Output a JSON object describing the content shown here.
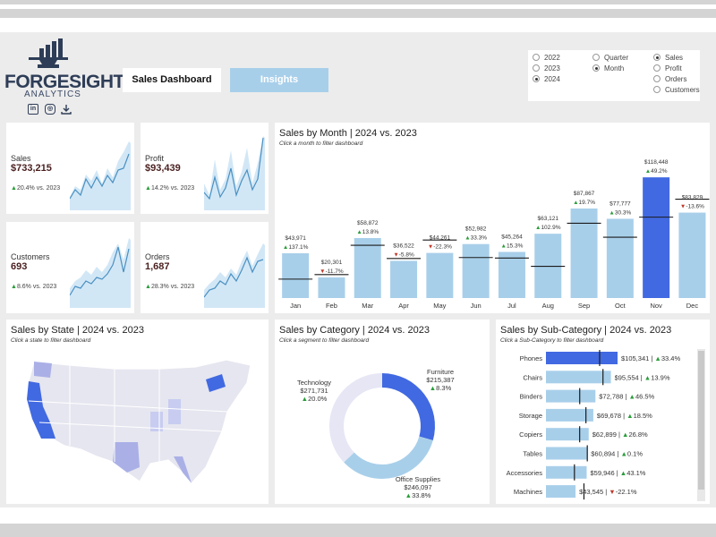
{
  "header": {
    "logo_text": "FORGESIGHT",
    "logo_sub": "ANALYTICS",
    "nav_buttons": [
      "Sales Dashboard",
      "Insights"
    ]
  },
  "filters": {
    "years": [
      {
        "label": "2022",
        "selected": false
      },
      {
        "label": "2023",
        "selected": false
      },
      {
        "label": "2024",
        "selected": true
      }
    ],
    "granularity": [
      {
        "label": "Quarter",
        "selected": false
      },
      {
        "label": "Month",
        "selected": true
      }
    ],
    "measures": [
      {
        "label": "Sales",
        "selected": true
      },
      {
        "label": "Profit",
        "selected": false
      },
      {
        "label": "Orders",
        "selected": false
      },
      {
        "label": "Customers",
        "selected": false
      }
    ]
  },
  "kpis": [
    {
      "title": "Sales",
      "value": "$733,215",
      "change": "20.4%",
      "suffix": " vs. 2023",
      "dir": "up"
    },
    {
      "title": "Profit",
      "value": "$93,439",
      "change": "14.2%",
      "suffix": " vs. 2023",
      "dir": "up"
    },
    {
      "title": "Customers",
      "value": "693",
      "change": "8.6%",
      "suffix": " vs. 2023",
      "dir": "up"
    },
    {
      "title": "Orders",
      "value": "1,687",
      "change": "28.3%",
      "suffix": " vs. 2023",
      "dir": "up"
    }
  ],
  "month_panel": {
    "title": "Sales by Month | 2024 vs. 2023",
    "subtitle": "Click a month to filter dashboard"
  },
  "state_panel": {
    "title": "Sales by State | 2024 vs. 2023",
    "subtitle": "Click a state to filter dashboard"
  },
  "category_panel": {
    "title": "Sales by Category | 2024 vs. 2023",
    "subtitle": "Click a segment to filter dashboard"
  },
  "subcat_panel": {
    "title": "Sales by Sub-Category | 2024 vs. 2023",
    "subtitle": "Click a Sub-Category to filter dashboard"
  },
  "chart_data": [
    {
      "type": "bar",
      "title": "Sales by Month | 2024 vs. 2023",
      "categories": [
        "Jan",
        "Feb",
        "Mar",
        "Apr",
        "May",
        "Jun",
        "Jul",
        "Aug",
        "Sep",
        "Oct",
        "Nov",
        "Dec"
      ],
      "series": [
        {
          "values": [
            43971,
            20301,
            58872,
            36522,
            44261,
            52982,
            45264,
            63121,
            87867,
            77777,
            118448,
            83829
          ]
        }
      ],
      "labels": [
        "$43,971",
        "$20,301",
        "$58,872",
        "$36,522",
        "$44,261",
        "$52,982",
        "$45,264",
        "$63,121",
        "$87,867",
        "$77,777",
        "$118,448",
        "$83,829"
      ],
      "changes": [
        {
          "text": "137.1%",
          "dir": "up"
        },
        {
          "text": "-11.7%",
          "dir": "down"
        },
        {
          "text": "13.8%",
          "dir": "up"
        },
        {
          "text": "-5.8%",
          "dir": "down"
        },
        {
          "text": "-22.3%",
          "dir": "down"
        },
        {
          "text": "33.3%",
          "dir": "up"
        },
        {
          "text": "15.3%",
          "dir": "up"
        },
        {
          "text": "102.9%",
          "dir": "up"
        },
        {
          "text": "19.7%",
          "dir": "up"
        },
        {
          "text": "30.3%",
          "dir": "up"
        },
        {
          "text": "49.2%",
          "dir": "up"
        },
        {
          "text": "-13.6%",
          "dir": "down"
        }
      ],
      "prior_year": [
        18546,
        22990,
        51740,
        38770,
        56960,
        39740,
        39260,
        31110,
        73410,
        59690,
        79380,
        97020
      ],
      "highlight_index": 10,
      "colors": {
        "bar": "#a8cfea",
        "highlight": "#4169e1",
        "prior_marker": "#1a1a1a"
      }
    },
    {
      "type": "pie",
      "title": "Sales by Category | 2024 vs. 2023",
      "categories": [
        "Technology",
        "Furniture",
        "Office Supplies"
      ],
      "values": [
        271731,
        215387,
        246097
      ],
      "value_labels": [
        "$271,731",
        "$215,387",
        "$246,097"
      ],
      "changes": [
        {
          "text": "20.0%",
          "dir": "up"
        },
        {
          "text": "8.3%",
          "dir": "up"
        },
        {
          "text": "33.8%",
          "dir": "up"
        }
      ],
      "colors": [
        "#e6e6f5",
        "#4169e1",
        "#a8cfea"
      ]
    },
    {
      "type": "bar",
      "title": "Sales by Sub-Category | 2024 vs. 2023",
      "categories": [
        "Phones",
        "Chairs",
        "Binders",
        "Storage",
        "Copiers",
        "Tables",
        "Accessories",
        "Machines"
      ],
      "series": [
        {
          "values": [
            105341,
            95554,
            72788,
            69678,
            62899,
            60894,
            59946,
            43545
          ]
        }
      ],
      "labels": [
        "$105,341",
        "$95,554",
        "$72,788",
        "$69,678",
        "$62,899",
        "$60,894",
        "$59,946",
        "$43,545"
      ],
      "changes": [
        {
          "text": "33.4%",
          "dir": "up"
        },
        {
          "text": "13.9%",
          "dir": "up"
        },
        {
          "text": "46.5%",
          "dir": "up"
        },
        {
          "text": "18.5%",
          "dir": "up"
        },
        {
          "text": "26.8%",
          "dir": "up"
        },
        {
          "text": "0.1%",
          "dir": "up"
        },
        {
          "text": "43.1%",
          "dir": "up"
        },
        {
          "text": "-22.1%",
          "dir": "down"
        }
      ],
      "prior_year": [
        78970,
        83890,
        49680,
        58800,
        49600,
        60830,
        41890,
        55900
      ],
      "highlight_index": 0,
      "colors": {
        "bar": "#a8cfea",
        "highlight": "#4169e1"
      }
    }
  ]
}
